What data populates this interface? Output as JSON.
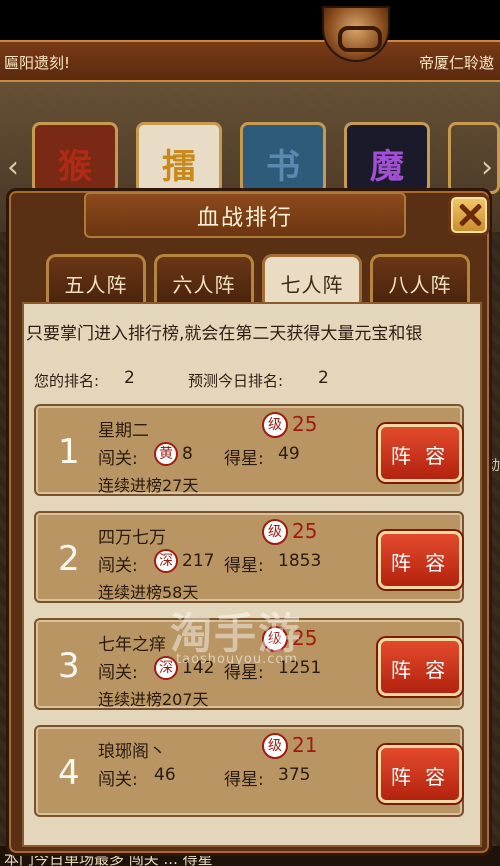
{
  "marquee": {
    "left": "匾阳遗刻!",
    "right": "帝厦仁聆遨"
  },
  "background_icons": [
    {
      "glyph": "猴",
      "color": "#b12a16",
      "bg": "#7a2a14"
    },
    {
      "glyph": "擂",
      "color": "#c88a1a",
      "bg": "#e8dcc6"
    },
    {
      "glyph": "书",
      "color": "#5a8ab0",
      "bg": "#2f5b7a"
    },
    {
      "glyph": "魔",
      "color": "#a050d0",
      "bg": "#1a1a2a"
    }
  ],
  "dialog": {
    "title": "血战排行"
  },
  "tabs": [
    {
      "label": "五人阵",
      "active": false
    },
    {
      "label": "六人阵",
      "active": false
    },
    {
      "label": "七人阵",
      "active": true
    },
    {
      "label": "八人阵",
      "active": false
    }
  ],
  "notice": "只要掌门进入排行榜,就会在第二天获得大量元宝和银",
  "info": {
    "your_rank_label": "您的排名:",
    "your_rank": "2",
    "predict_label": "预测今日排名:",
    "predict_rank": "2"
  },
  "rows": [
    {
      "rank": "1",
      "name": "星期二",
      "level_badge": "级",
      "level": "25",
      "stage_label": "闯关:",
      "difficulty": "黄",
      "stage": "8",
      "star_label": "得星:",
      "stars": "49",
      "streak": "连续进榜27天",
      "button": "阵 容"
    },
    {
      "rank": "2",
      "name": "四万七万",
      "level_badge": "级",
      "level": "25",
      "stage_label": "闯关:",
      "difficulty": "深",
      "stage": "217",
      "star_label": "得星:",
      "stars": "1853",
      "streak": "连续进榜58天",
      "button": "阵 容"
    },
    {
      "rank": "3",
      "name": "七年之痒",
      "level_badge": "级",
      "level": "25",
      "stage_label": "闯关:",
      "difficulty": "深",
      "stage": "142",
      "star_label": "得星:",
      "stars": "1251",
      "streak": "连续进榜207天",
      "button": "阵 容"
    },
    {
      "rank": "4",
      "name": "琅琊阁丶",
      "level_badge": "级",
      "level": "21",
      "stage_label": "闯关:",
      "difficulty": "",
      "stage": "46",
      "star_label": "得星:",
      "stars": "375",
      "streak": "",
      "button": "阵 容"
    }
  ],
  "watermark": {
    "main": "淘手游",
    "sub": "taoshouyou.com"
  },
  "bottom_text": "本门今日单场最多  闯关  ...  得星",
  "side_char": "动"
}
